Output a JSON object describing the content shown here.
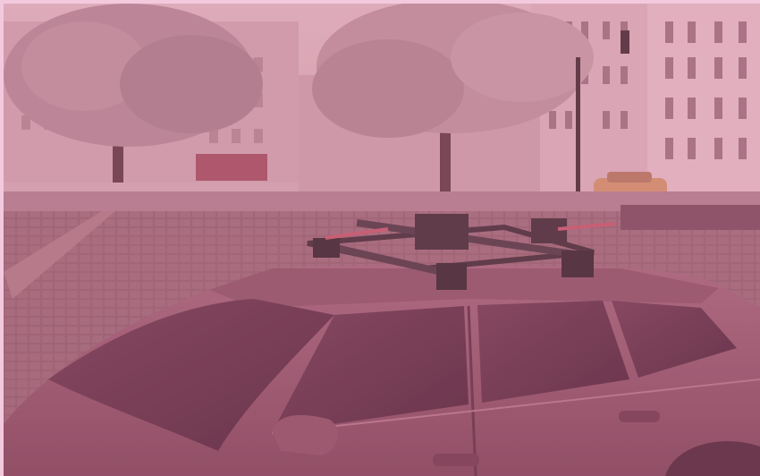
{
  "image": {
    "subject": "station-wagon-with-roof-mounted-ski-carrier",
    "tint_color": "#c76b95",
    "frame_color": "#f3c9dd"
  }
}
